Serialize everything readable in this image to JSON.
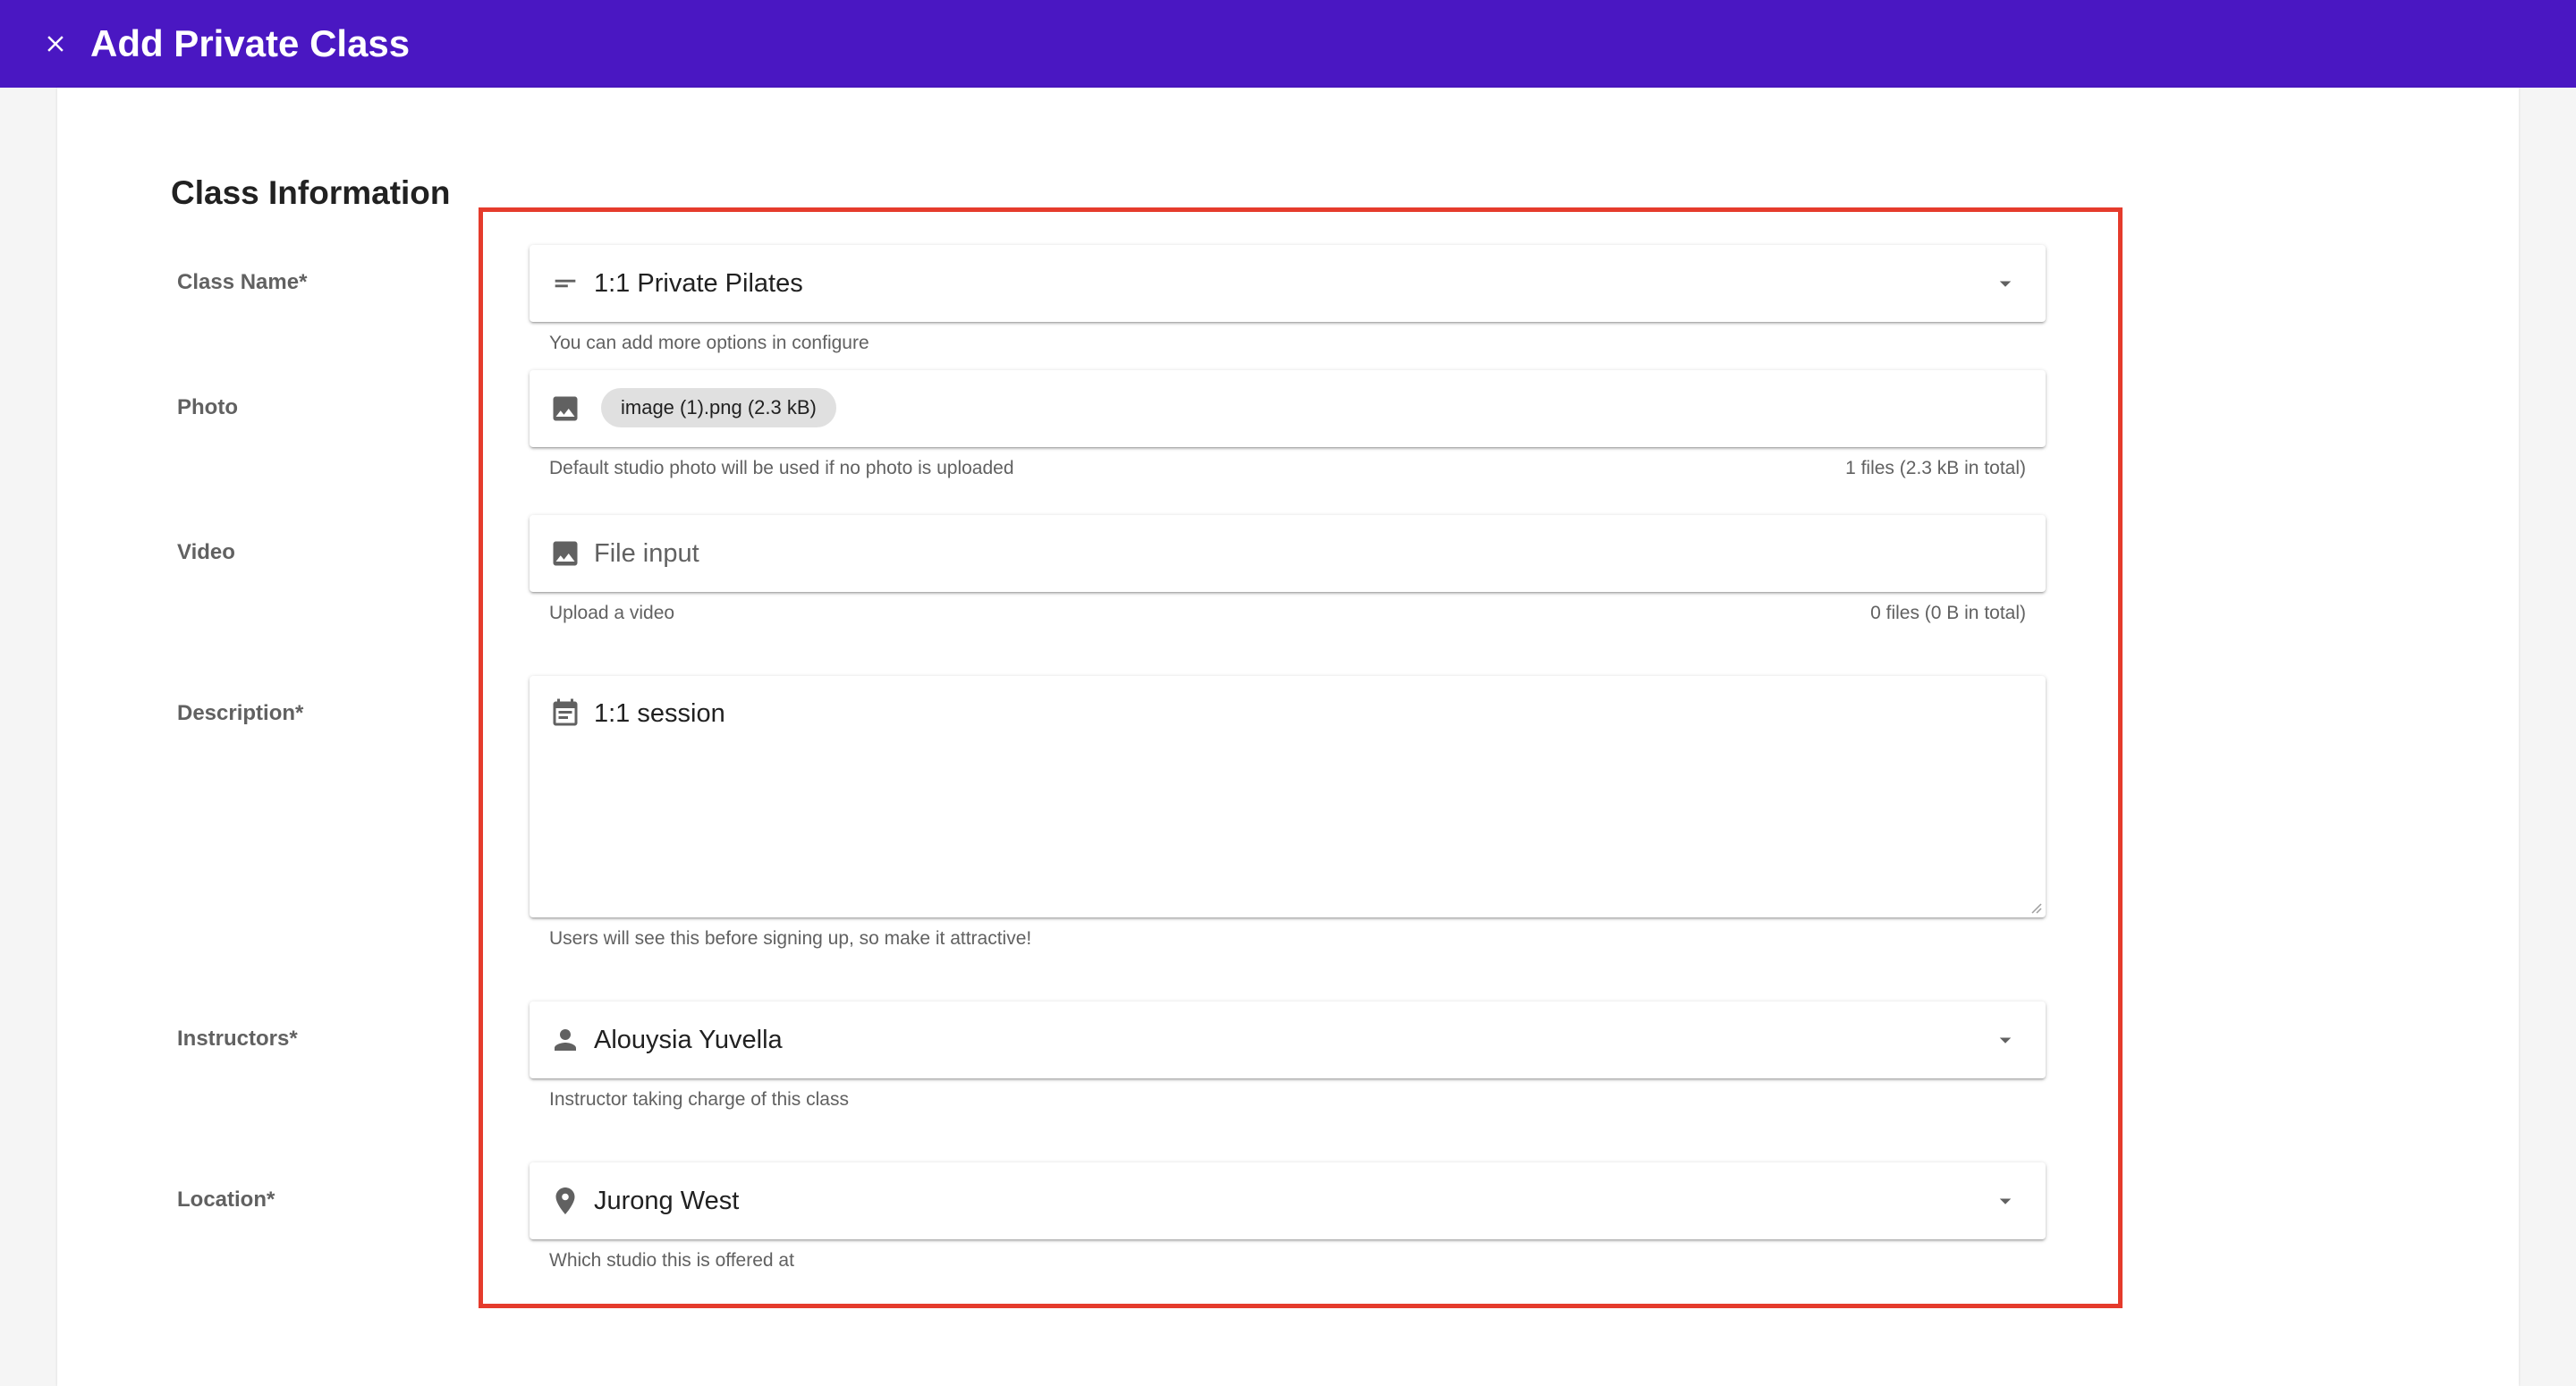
{
  "header": {
    "title": "Add Private Class",
    "close_icon": "close-icon",
    "background": "#4a17c2"
  },
  "section": {
    "title": "Class Information"
  },
  "form": {
    "class_name": {
      "label": "Class Name*",
      "value": "1:1 Private Pilates",
      "icon": "short-text-icon",
      "hint": "You can add more options in configure"
    },
    "photo": {
      "label": "Photo",
      "icon": "image-icon",
      "chip": "image (1).png (2.3 kB)",
      "hint": "Default studio photo will be used if no photo is uploaded",
      "counter": "1 files (2.3 kB in total)"
    },
    "video": {
      "label": "Video",
      "icon": "image-icon",
      "placeholder": "File input",
      "hint": "Upload a video",
      "counter": "0 files (0 B in total)"
    },
    "description": {
      "label": "Description*",
      "icon": "event-note-icon",
      "value": "1:1 session",
      "hint": "Users will see this before signing up, so make it attractive!"
    },
    "instructors": {
      "label": "Instructors*",
      "icon": "person-icon",
      "value": "Alouysia Yuvella",
      "hint": "Instructor taking charge of this class"
    },
    "location": {
      "label": "Location*",
      "icon": "location-pin-icon",
      "value": "Jurong West",
      "hint": "Which studio this is offered at"
    }
  },
  "colors": {
    "accent": "#4a17c2",
    "highlight": "#e53b2c"
  }
}
